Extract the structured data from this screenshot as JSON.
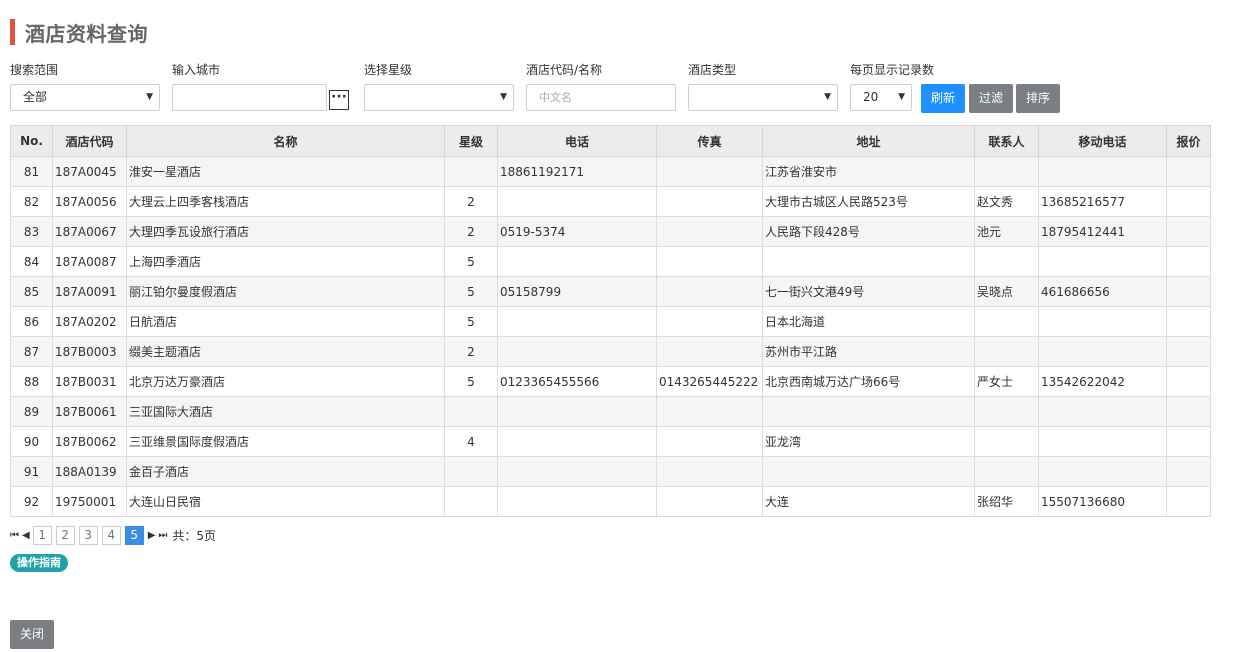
{
  "page": {
    "title": "酒店资料查询"
  },
  "filters": {
    "scope": {
      "label": "搜索范围",
      "value": "全部"
    },
    "city": {
      "label": "输入城市",
      "value": ""
    },
    "star": {
      "label": "选择星级",
      "value": ""
    },
    "code": {
      "label": "酒店代码/名称",
      "placeholder": "中文名"
    },
    "type": {
      "label": "酒店类型",
      "value": ""
    },
    "page_size": {
      "label": "每页显示记录数",
      "value": "20"
    }
  },
  "buttons": {
    "refresh": "刷新",
    "filter": "过滤",
    "sort": "排序",
    "dots": "···",
    "close": "关闭"
  },
  "table": {
    "headers": [
      "No.",
      "酒店代码",
      "名称",
      "星级",
      "电话",
      "传真",
      "地址",
      "联系人",
      "移动电话",
      "报价"
    ],
    "rows": [
      [
        "81",
        "187A0045",
        "淮安一星酒店",
        "",
        "18861192171",
        "",
        "江苏省淮安市",
        "",
        "",
        ""
      ],
      [
        "82",
        "187A0056",
        "大理云上四季客栈酒店",
        "2",
        "",
        "",
        "大理市古城区人民路523号",
        "赵文秀",
        "13685216577",
        ""
      ],
      [
        "83",
        "187A0067",
        "大理四季瓦设旅行酒店",
        "2",
        "0519-5374",
        "",
        "人民路下段428号",
        "池元",
        "18795412441",
        ""
      ],
      [
        "84",
        "187A0087",
        "上海四季酒店",
        "5",
        "",
        "",
        "",
        "",
        "",
        ""
      ],
      [
        "85",
        "187A0091",
        "丽江铂尔曼度假酒店",
        "5",
        "05158799",
        "",
        "七一街兴文港49号",
        "吴晓点",
        "461686656",
        ""
      ],
      [
        "86",
        "187A0202",
        "日航酒店",
        "5",
        "",
        "",
        "日本北海道",
        "",
        "",
        ""
      ],
      [
        "87",
        "187B0003",
        "缀美主题酒店",
        "2",
        "",
        "",
        "苏州市平江路",
        "",
        "",
        ""
      ],
      [
        "88",
        "187B0031",
        "北京万达万豪酒店",
        "5",
        "0123365455566",
        "0143265445222",
        "北京西南城万达广场66号",
        "严女士",
        "13542622042",
        ""
      ],
      [
        "89",
        "187B0061",
        "三亚国际大酒店",
        "",
        "",
        "",
        "",
        "",
        "",
        ""
      ],
      [
        "90",
        "187B0062",
        "三亚维景国际度假酒店",
        "4",
        "",
        "",
        "亚龙湾",
        "",
        "",
        ""
      ],
      [
        "91",
        "188A0139",
        "金百子酒店",
        "",
        "",
        "",
        "",
        "",
        "",
        ""
      ],
      [
        "92",
        "19750001",
        "大连山日民宿",
        "",
        "",
        "",
        "大连",
        "张绍华",
        "15507136680",
        ""
      ]
    ]
  },
  "pager": {
    "first": "⏮",
    "prev": "◀",
    "next": "▶",
    "last": "⏭",
    "pages": [
      "1",
      "2",
      "3",
      "4",
      "5"
    ],
    "active": "5",
    "total_text": "共：5页"
  },
  "guide": {
    "label": "操作指南"
  },
  "icons": {
    "caret": "▼",
    "ellipsis": "more-icon"
  },
  "colors": {
    "accent": "#e5533d",
    "primary": "#1e90ff",
    "gray_button": "#7b7f83",
    "guide": "#1fa3a8",
    "active_page": "#3a8ee6"
  }
}
